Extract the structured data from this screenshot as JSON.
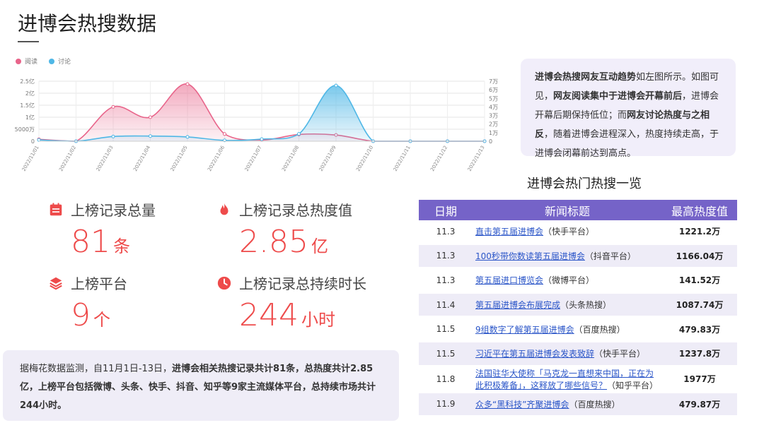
{
  "page_title": "进博会热搜数据",
  "legend": [
    {
      "name": "阅读",
      "color": "#e8648a"
    },
    {
      "name": "讨论",
      "color": "#4fb7e6"
    }
  ],
  "chart_data": {
    "type": "area",
    "x": [
      "2022/11/01",
      "2022/11/02",
      "2022/11/03",
      "2022/11/04",
      "2022/11/05",
      "2022/11/06",
      "2022/11/07",
      "2022/11/08",
      "2022/11/09",
      "2022/11/10",
      "2022/11/11",
      "2022/11/12",
      "2022/11/13"
    ],
    "left_axis_ticks": [
      "0",
      "5000万",
      "1亿",
      "1.5亿",
      "2亿",
      "2.5亿"
    ],
    "right_axis_ticks": [
      "0",
      "1万",
      "2万",
      "3万",
      "4万",
      "5万",
      "6万",
      "7万"
    ],
    "ylim_left": [
      0,
      25000
    ],
    "ylim_right": [
      0,
      7
    ],
    "series": [
      {
        "name": "阅读",
        "axis": "left",
        "color": "#e8648a",
        "unit": "万",
        "values": [
          800,
          0,
          14300,
          10000,
          23800,
          3000,
          500,
          2800,
          2600,
          0,
          0,
          0,
          0
        ]
      },
      {
        "name": "讨论",
        "axis": "right",
        "color": "#4fb7e6",
        "unit": "万",
        "values": [
          0.15,
          0,
          0.55,
          0.6,
          0.5,
          0.1,
          0.25,
          0.85,
          6.5,
          0,
          0,
          0,
          0
        ]
      }
    ],
    "grid": true
  },
  "stats": [
    {
      "label": "上榜记录总量",
      "value": "81",
      "unit": "条",
      "icon": "list-icon"
    },
    {
      "label": "上榜记录总热度值",
      "value": "2.85",
      "unit": "亿",
      "icon": "flame-icon"
    },
    {
      "label": "上榜平台",
      "value": "9",
      "unit": "个",
      "icon": "layers-icon"
    },
    {
      "label": "上榜记录总持续时长",
      "value": "244",
      "unit": "小时",
      "icon": "clock-icon"
    }
  ],
  "note": {
    "b1": "进博会热搜网友互动趋势",
    "t1": "如左图所示。如图可见，",
    "b2": "网友阅读集中于进博会开幕前后",
    "t2": "，进博会开幕后期保持低位；而",
    "b3": "网友讨论热度与之相反",
    "t3": "，随着进博会进程深入，热度持续走高，于进博会闭幕前达到高点。"
  },
  "summary": {
    "t1": "据梅花数据监测，自11月1日-13日，",
    "b1": "进博会相关热搜记录共计81条，总热度共计2.85亿，上榜平台包括微博、头条、快手、抖音、知乎等9家主流媒体平台，总持续市场共计244小时。"
  },
  "table": {
    "title": "进博会热门热搜一览",
    "headers": [
      "日期",
      "新闻标题",
      "最高热度值"
    ],
    "rows": [
      {
        "date": "11.3",
        "title": "直击第五届进博会",
        "source": "（快手平台）",
        "heat": "1221.2万"
      },
      {
        "date": "11.3",
        "title": "100秒带你数读第五届进博会",
        "source": "（抖音平台）",
        "heat": "1166.04万"
      },
      {
        "date": "11.3",
        "title": "第五届进口博览会",
        "source": "（微博平台）",
        "heat": "141.52万"
      },
      {
        "date": "11.4",
        "title": "第五届进博会布展完成",
        "source": "（头条热搜）",
        "heat": "1087.74万"
      },
      {
        "date": "11.5",
        "title": "9组数字了解第五届进博会",
        "source": "（百度热搜）",
        "heat": "479.83万"
      },
      {
        "date": "11.5",
        "title": "习近平在第五届进博会发表致辞",
        "source": "（快手平台）",
        "heat": "1237.8万"
      },
      {
        "date": "11.8",
        "title": "法国驻华大使称「马克龙一直想来中国，正在为此积极筹备」，这释放了哪些信号？",
        "source": "（知乎平台）",
        "heat": "1977万"
      },
      {
        "date": "11.9",
        "title": "众多“黑科技”齐聚进博会",
        "source": "（百度热搜）",
        "heat": "479.87万"
      }
    ]
  }
}
